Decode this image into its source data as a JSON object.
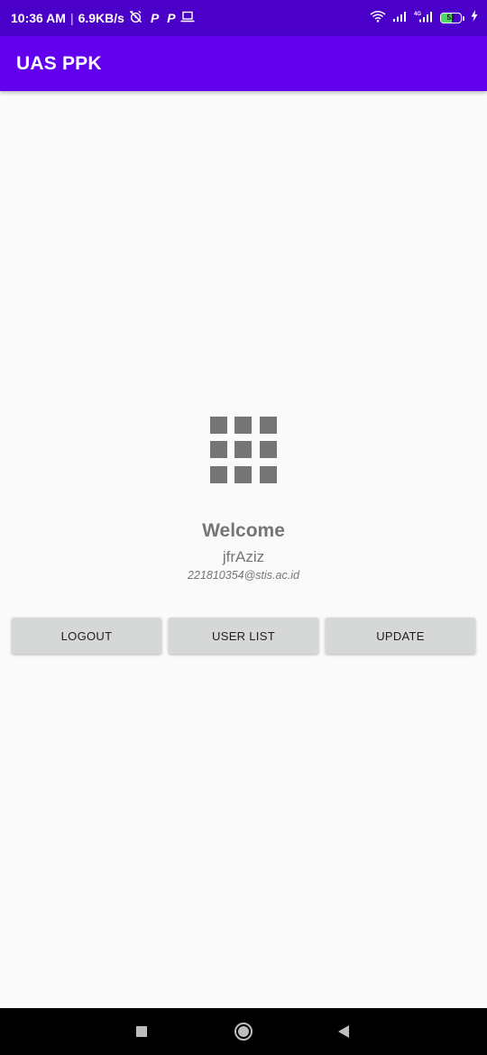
{
  "status_bar": {
    "time": "10:36 AM",
    "separator": "|",
    "net_speed": "6.9KB/s",
    "app_icon_1": "P",
    "app_icon_2": "P",
    "battery_level": 53,
    "battery_label": "53",
    "icons": [
      "alarm-off-icon",
      "parking-app-icon",
      "parking-app-icon",
      "laptop-icon",
      "wifi-icon",
      "signal-icon",
      "4g-signal-icon",
      "battery-icon",
      "charging-bolt-icon"
    ],
    "background_color": "#4a00c8"
  },
  "app_bar": {
    "title": "UAS PPK",
    "background_color": "#6200ee"
  },
  "profile": {
    "icon": "apps-grid-icon",
    "welcome": "Welcome",
    "username": "jfrAziz",
    "email": "221810354@stis.ac.id"
  },
  "actions": {
    "logout": "LOGOUT",
    "user_list": "USER LIST",
    "update": "UPDATE"
  },
  "nav_bar": {
    "icons": [
      "recents-icon",
      "home-icon",
      "back-icon"
    ]
  },
  "colors": {
    "page_background": "#fafafa",
    "text_gray": "#757575",
    "button_background": "#d6d7d7",
    "battery_fill": "#4cd964"
  }
}
